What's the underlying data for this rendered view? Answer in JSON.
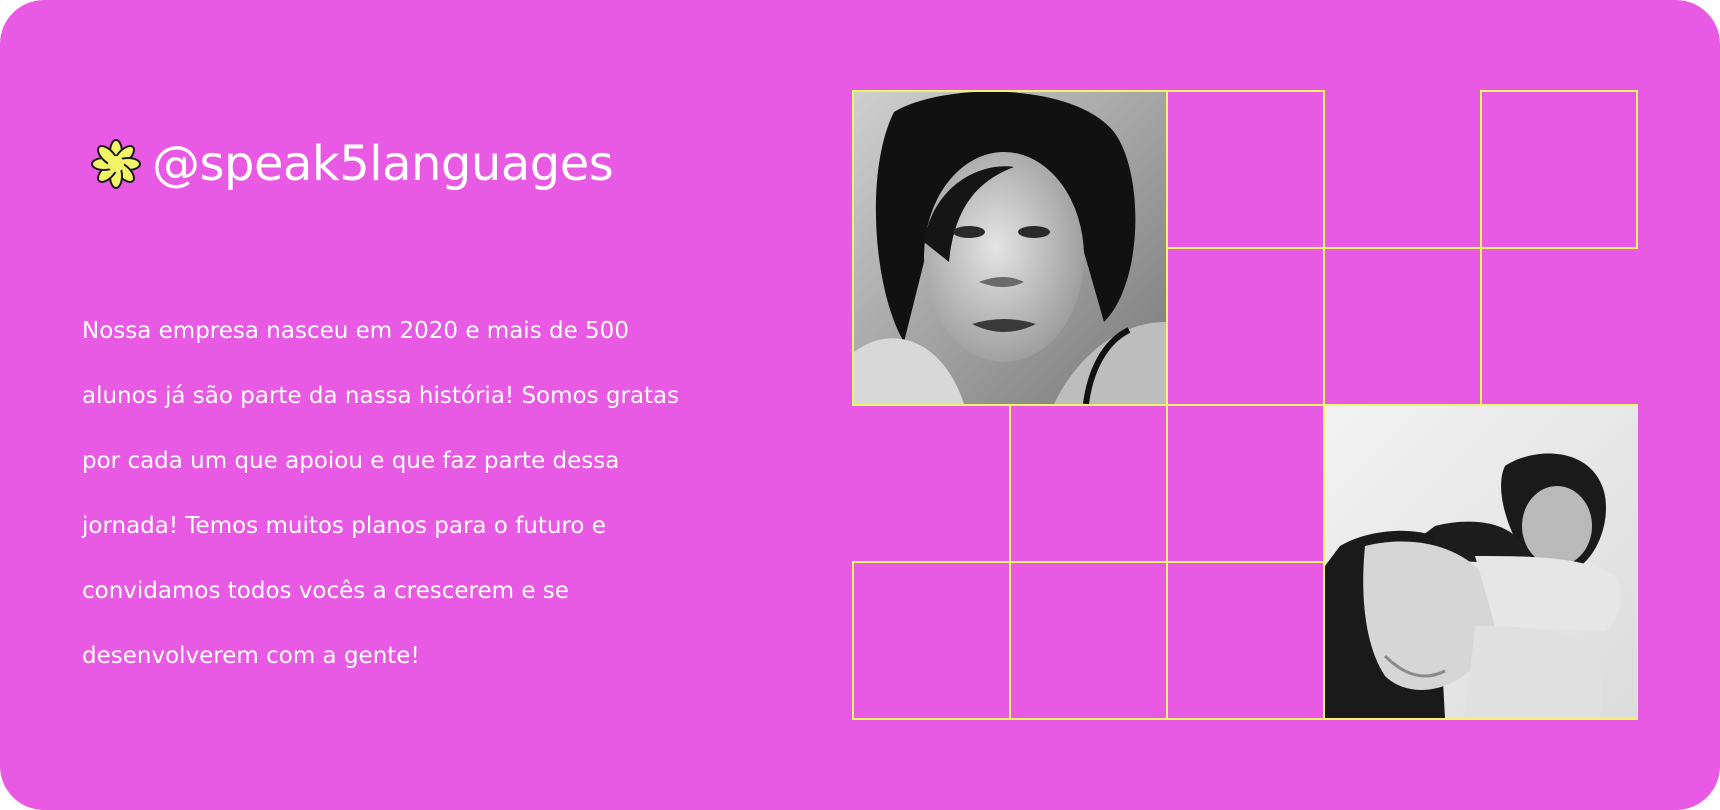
{
  "brand": {
    "handle": "@speak5languages",
    "icon": "asterisk-flower-icon",
    "icon_color": "#f4f566"
  },
  "about": {
    "lines": [
      "Nossa empresa nasceu em 2020 e mais de 500",
      "alunos já são parte da nassa história! Somos gratas",
      "por cada um que apoiou e que faz parte dessa",
      "jornada! Temos muitos planos para o futuro e",
      "convidamos todos vocês a crescerem e se",
      "desenvolverem com a gente!"
    ]
  },
  "gallery": {
    "photos": [
      {
        "name": "photo-woman-portrait",
        "description": "black-and-white portrait"
      },
      {
        "name": "photo-woman-sitting",
        "description": "black-and-white seated pose"
      }
    ]
  },
  "colors": {
    "background": "#e95ae4",
    "grid_line": "#f4f566",
    "text": "#ffffff"
  }
}
